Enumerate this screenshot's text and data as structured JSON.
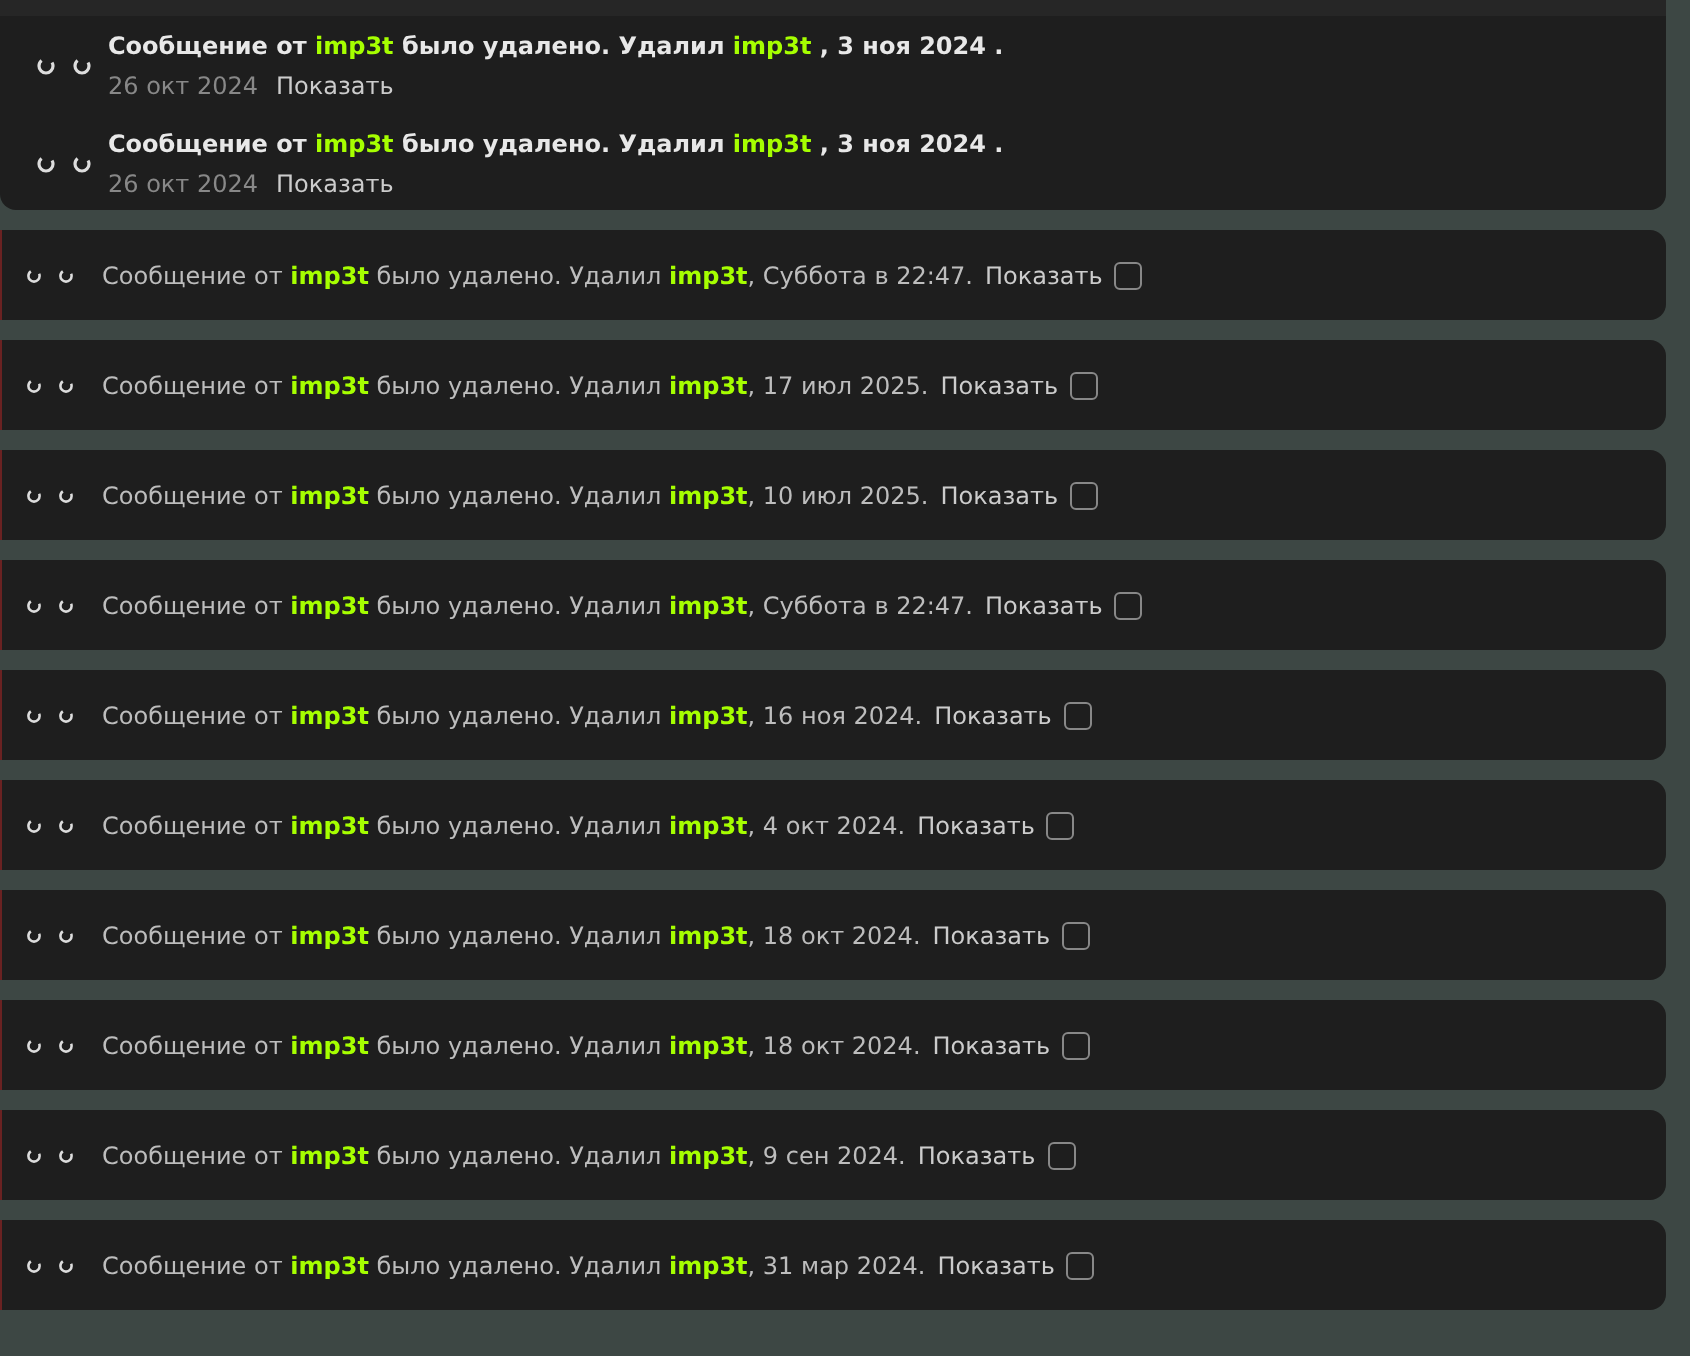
{
  "top_panel": {
    "entries": [
      {
        "message": "Сообщение от **imp3t** было удалено. Удалил **imp3t** , 3 ноя 2024 .",
        "date": "26 окт 2024",
        "show_label": "Показать"
      },
      {
        "message": "Сообщение от **imp3t** было удалено. Удалил **imp3t** , 3 ноя 2024 .",
        "date": "26 окт 2024",
        "show_label": "Показать"
      }
    ]
  },
  "rows": [
    {
      "message": "Сообщение от **imp3t** было удалено. Удалил **imp3t**, Суббота в 22:47.",
      "show_label": "Показать",
      "checked": false
    },
    {
      "message": "Сообщение от **imp3t** было удалено. Удалил **imp3t**, 17 июл 2025.",
      "show_label": "Показать",
      "checked": false
    },
    {
      "message": "Сообщение от **imp3t** было удалено. Удалил **imp3t**, 10 июл 2025.",
      "show_label": "Показать",
      "checked": false
    },
    {
      "message": "Сообщение от **imp3t** было удалено. Удалил **imp3t**, Суббота в 22:47.",
      "show_label": "Показать",
      "checked": false
    },
    {
      "message": "Сообщение от **imp3t** было удалено. Удалил **imp3t**, 16 ноя 2024.",
      "show_label": "Показать",
      "checked": false
    },
    {
      "message": "Сообщение от **imp3t** было удалено. Удалил **imp3t**, 4 окт 2024.",
      "show_label": "Показать",
      "checked": false
    },
    {
      "message": "Сообщение от **imp3t** было удалено. Удалил **imp3t**, 18 окт 2024.",
      "show_label": "Показать",
      "checked": false
    },
    {
      "message": "Сообщение от **imp3t** было удалено. Удалил **imp3t**, 18 окт 2024.",
      "show_label": "Показать",
      "checked": false
    },
    {
      "message": "Сообщение от **imp3t** было удалено. Удалил **imp3t**, 9 сен 2024.",
      "show_label": "Показать",
      "checked": false
    },
    {
      "message": "Сообщение от **imp3t** было удалено. Удалил **imp3t**, 31 мар 2024.",
      "show_label": "Показать",
      "checked": false
    }
  ]
}
